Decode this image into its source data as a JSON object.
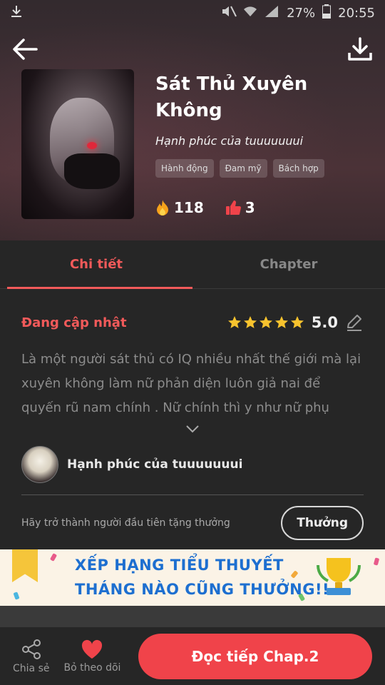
{
  "status_bar": {
    "battery": "27%",
    "time": "20:55"
  },
  "book": {
    "title": "Sát Thủ Xuyên Không",
    "author": "Hạnh phúc của tuuuuuuui",
    "tags": [
      "Hành động",
      "Đam mỹ",
      "Bách hợp"
    ],
    "views": "118",
    "likes": "3"
  },
  "tabs": [
    {
      "label": "Chi tiết",
      "active": true
    },
    {
      "label": "Chapter",
      "active": false
    }
  ],
  "detail": {
    "status": "Đang cập nhật",
    "rating": "5.0",
    "stars": 5,
    "description": "Là một người sát thủ có IQ nhiều nhất thế giới mà lại xuyên không làm nữ phản diện luôn giả nai để quyến rũ nam chính . Nữ chính thì y như nữ phụ"
  },
  "uploader": {
    "name": "Hạnh phúc của tuuuuuuui"
  },
  "reward": {
    "text": "Hãy trở thành người đầu tiên tặng thưởng",
    "button": "Thưởng"
  },
  "banner": {
    "line1": "XẾP HẠNG TIỂU THUYẾT",
    "line2": "THÁNG NÀO CŨNG THƯỞNG!!"
  },
  "bottom_bar": {
    "share": "Chia sẻ",
    "unfollow": "Bỏ theo dõi",
    "read": "Đọc tiếp Chap.2"
  },
  "colors": {
    "accent": "#f25a5a",
    "read_button": "#f0434a",
    "banner_text": "#1d6fd0"
  }
}
